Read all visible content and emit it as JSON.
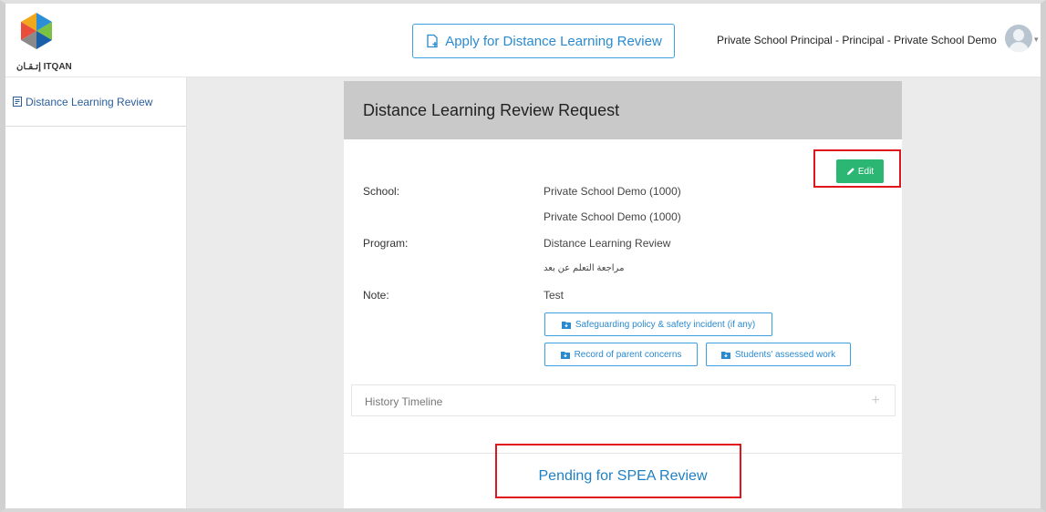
{
  "header": {
    "logo_text": "إتـقـان ITQAN",
    "apply_button_label": "Apply for Distance Learning Review",
    "user_label": "Private School Principal - Principal - Private School Demo"
  },
  "sidebar": {
    "items": [
      {
        "label": "Distance Learning Review",
        "icon": "document-icon"
      }
    ]
  },
  "card": {
    "title": "Distance Learning Review Request",
    "edit_label": "Edit",
    "fields": {
      "school_label": "School:",
      "school_value": "Private School Demo (1000)",
      "school_value_2": "Private School Demo (1000)",
      "program_label": "Program:",
      "program_value": "Distance Learning Review",
      "program_value_ar": "مراجعة التعلم عن بعد",
      "note_label": "Note:",
      "note_value": "Test"
    },
    "files": [
      "Safeguarding policy & safety incident (if any)",
      "Record of parent concerns",
      "Students' assessed work"
    ],
    "history_label": "History Timeline",
    "history_toggle": "+",
    "status": "Pending for SPEA Review"
  },
  "colors": {
    "accent_blue": "#2a8ad0",
    "edit_green": "#2bb673",
    "highlight_red": "#e0161c",
    "header_gray": "#c9c9c9"
  }
}
